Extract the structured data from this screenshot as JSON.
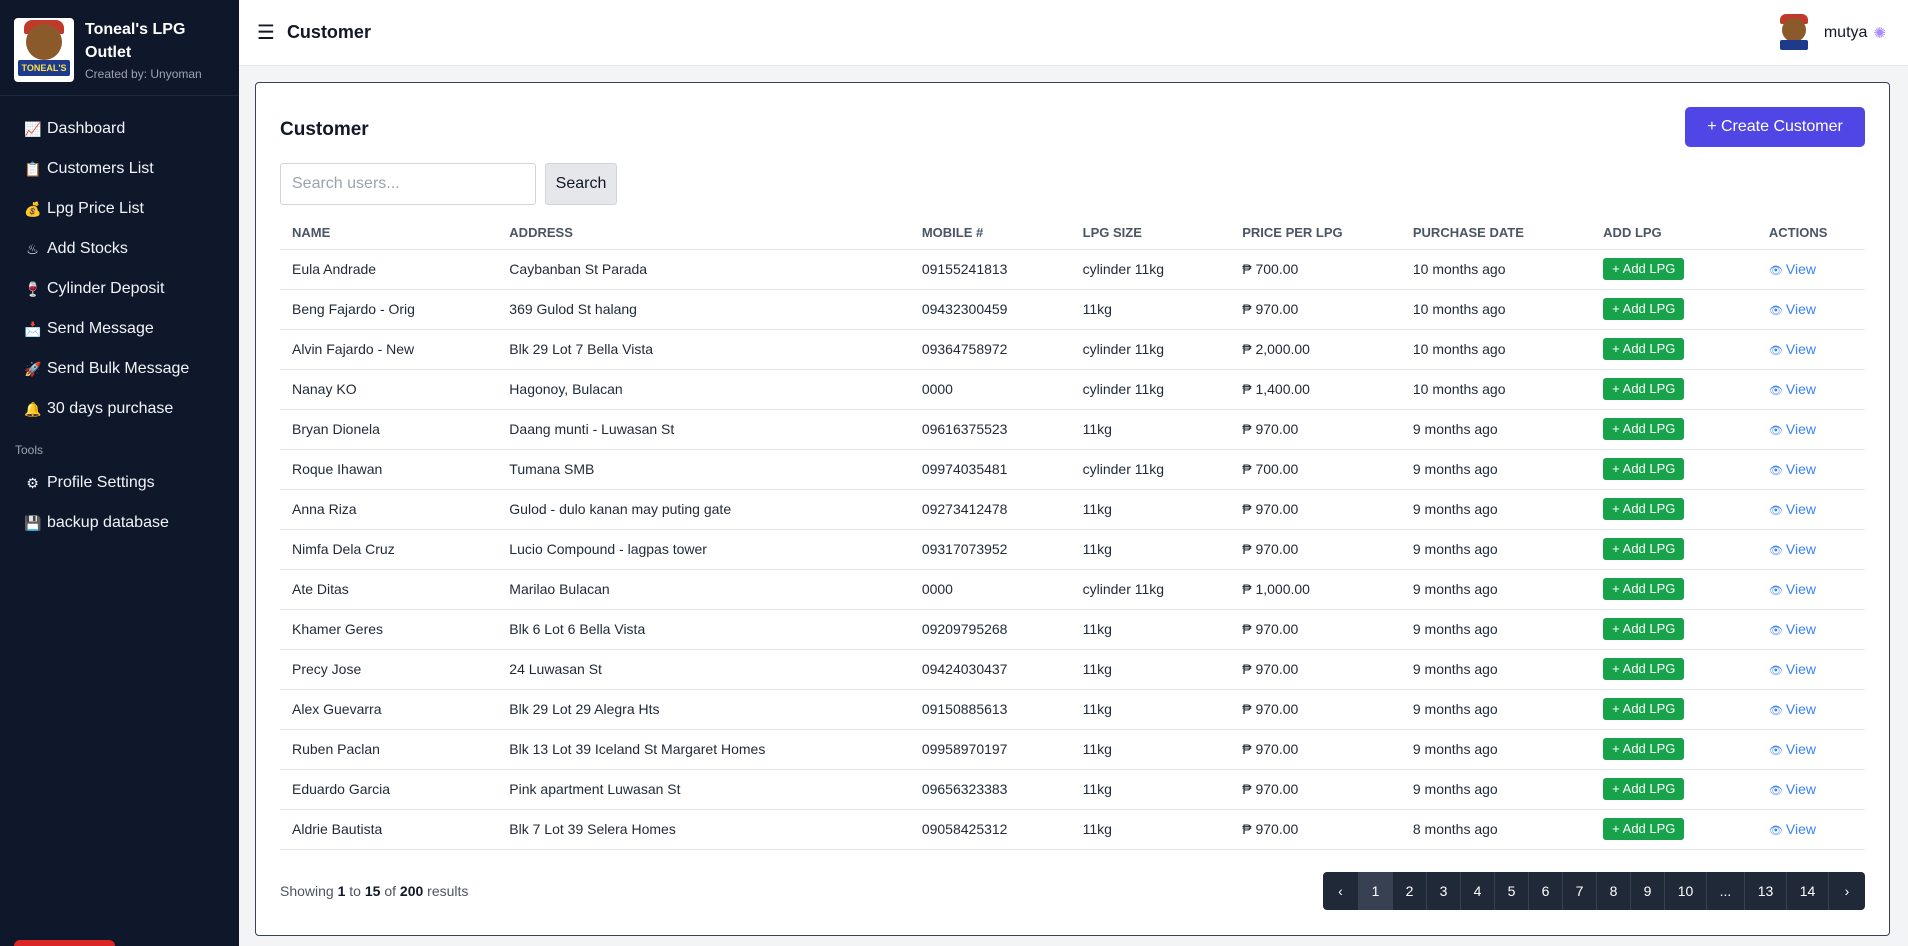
{
  "app": {
    "brand_title": "Toneal's LPG Outlet",
    "brand_sub": "Created by: Unyoman",
    "logo_text": "TONEAL'S"
  },
  "sidebar": {
    "items": [
      {
        "icon": "📈",
        "label": "Dashboard"
      },
      {
        "icon": "📋",
        "label": "Customers List"
      },
      {
        "icon": "💰",
        "label": "Lpg Price List"
      },
      {
        "icon": "♨",
        "label": "Add Stocks"
      },
      {
        "icon": "🍷",
        "label": "Cylinder Deposit"
      },
      {
        "icon": "📩",
        "label": "Send Message"
      },
      {
        "icon": "🚀",
        "label": "Send Bulk Message"
      },
      {
        "icon": "🔔",
        "label": "30 days purchase"
      }
    ],
    "tools_label": "Tools",
    "tools": [
      {
        "icon": "⚙",
        "label": "Profile Settings"
      },
      {
        "icon": "💾",
        "label": "backup database"
      }
    ]
  },
  "topbar": {
    "menu_icon": "☰",
    "title": "Customer",
    "user_name": "mutya",
    "gear_icon": "✺"
  },
  "card": {
    "title": "Customer",
    "create_label": "+ Create Customer",
    "search_placeholder": "Search users...",
    "search_label": "Search"
  },
  "table": {
    "columns": [
      "Name",
      "Address",
      "Mobile #",
      "LPG Size",
      "Price per LPG",
      "Purchase Date",
      "Add LPG",
      "Actions"
    ],
    "add_label": "+ Add LPG",
    "view_label": "View",
    "rows": [
      {
        "name": "Eula Andrade",
        "address": "Caybanban St Parada",
        "mobile": "09155241813",
        "size": "cylinder 11kg",
        "price": "₱ 700.00",
        "date": "10 months ago"
      },
      {
        "name": "Beng Fajardo - Orig",
        "address": "369 Gulod St halang",
        "mobile": "09432300459",
        "size": "11kg",
        "price": "₱ 970.00",
        "date": "10 months ago"
      },
      {
        "name": "Alvin Fajardo - New",
        "address": "Blk 29 Lot 7 Bella Vista",
        "mobile": "09364758972",
        "size": "cylinder 11kg",
        "price": "₱ 2,000.00",
        "date": "10 months ago"
      },
      {
        "name": "Nanay KO",
        "address": "Hagonoy, Bulacan",
        "mobile": "0000",
        "size": "cylinder 11kg",
        "price": "₱ 1,400.00",
        "date": "10 months ago"
      },
      {
        "name": "Bryan Dionela",
        "address": "Daang munti - Luwasan St",
        "mobile": "09616375523",
        "size": "11kg",
        "price": "₱ 970.00",
        "date": "9 months ago"
      },
      {
        "name": "Roque Ihawan",
        "address": "Tumana SMB",
        "mobile": "09974035481",
        "size": "cylinder 11kg",
        "price": "₱ 700.00",
        "date": "9 months ago"
      },
      {
        "name": "Anna Riza",
        "address": "Gulod - dulo kanan may puting gate",
        "mobile": "09273412478",
        "size": "11kg",
        "price": "₱ 970.00",
        "date": "9 months ago"
      },
      {
        "name": "Nimfa Dela Cruz",
        "address": "Lucio Compound - lagpas tower",
        "mobile": "09317073952",
        "size": "11kg",
        "price": "₱ 970.00",
        "date": "9 months ago"
      },
      {
        "name": "Ate Ditas",
        "address": "Marilao Bulacan",
        "mobile": "0000",
        "size": "cylinder 11kg",
        "price": "₱ 1,000.00",
        "date": "9 months ago"
      },
      {
        "name": "Khamer Geres",
        "address": "Blk 6 Lot 6 Bella Vista",
        "mobile": "09209795268",
        "size": "11kg",
        "price": "₱ 970.00",
        "date": "9 months ago"
      },
      {
        "name": "Precy Jose",
        "address": "24 Luwasan St",
        "mobile": "09424030437",
        "size": "11kg",
        "price": "₱ 970.00",
        "date": "9 months ago"
      },
      {
        "name": "Alex Guevarra",
        "address": "Blk 29 Lot 29 Alegra Hts",
        "mobile": "09150885613",
        "size": "11kg",
        "price": "₱ 970.00",
        "date": "9 months ago"
      },
      {
        "name": "Ruben Paclan",
        "address": "Blk 13 Lot 39 Iceland St Margaret Homes",
        "mobile": "09958970197",
        "size": "11kg",
        "price": "₱ 970.00",
        "date": "9 months ago"
      },
      {
        "name": "Eduardo Garcia",
        "address": "Pink apartment Luwasan St",
        "mobile": "09656323383",
        "size": "11kg",
        "price": "₱ 970.00",
        "date": "9 months ago"
      },
      {
        "name": "Aldrie Bautista",
        "address": "Blk 7 Lot 39 Selera Homes",
        "mobile": "09058425312",
        "size": "11kg",
        "price": "₱ 970.00",
        "date": "8 months ago"
      }
    ]
  },
  "footer": {
    "showing_prefix": "Showing",
    "from": "1",
    "to_word": "to",
    "to": "15",
    "of_word": "of",
    "total": "200",
    "results_word": "results"
  },
  "pagination": {
    "prev_icon": "‹",
    "next_icon": "›",
    "pages": [
      "1",
      "2",
      "3",
      "4",
      "5",
      "6",
      "7",
      "8",
      "9",
      "10",
      "...",
      "13",
      "14"
    ],
    "active": "1"
  },
  "colors": {
    "sidebar_bg": "#0f172a",
    "primary": "#4f46e5",
    "success": "#16a34a",
    "link": "#3b82f6",
    "pager_bg": "#1f2937"
  }
}
